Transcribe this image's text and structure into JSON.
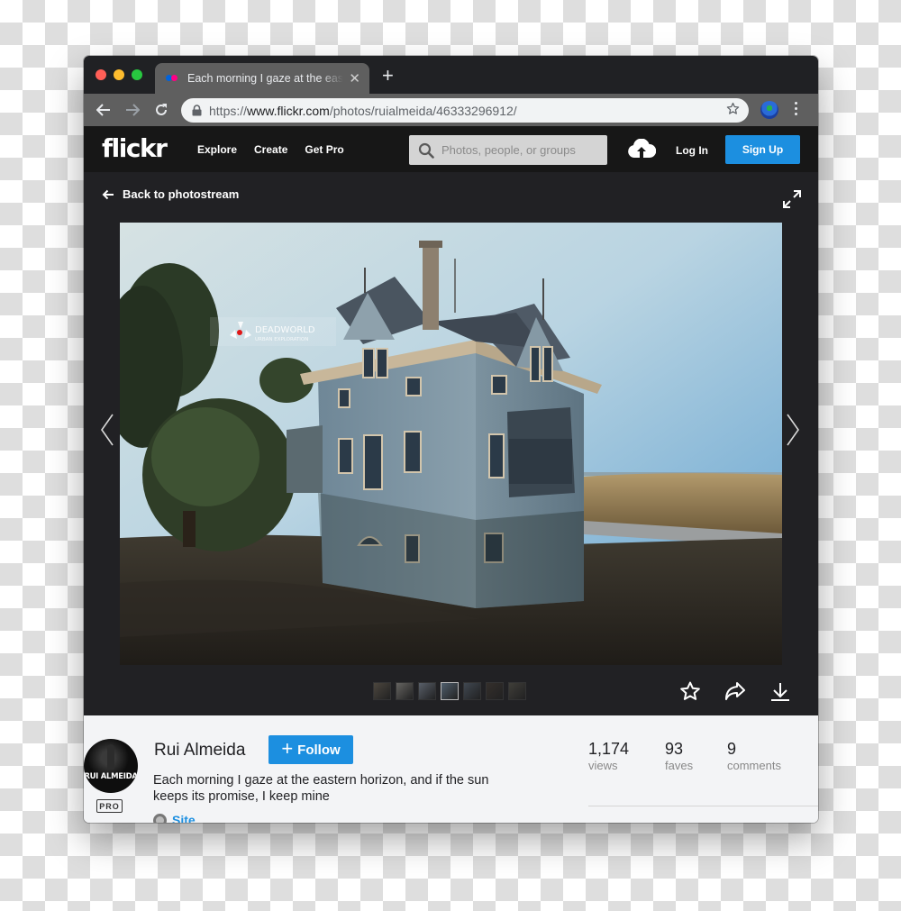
{
  "browser": {
    "tab_title": "Each morning I gaze at the eastern horizon, and if the sun keeps its promise, I keep mine",
    "url_prefix": "https://",
    "url_host": "www.flickr.com",
    "url_path": "/photos/ruialmeida/46333296912/",
    "new_tab_label": "+",
    "close_tab_label": "✕"
  },
  "header": {
    "logo": "flickr",
    "nav": [
      {
        "label": "Explore"
      },
      {
        "label": "Create"
      },
      {
        "label": "Get Pro"
      }
    ],
    "search_placeholder": "Photos, people, or groups",
    "login_label": "Log In",
    "signup_label": "Sign Up"
  },
  "stage": {
    "back_label": "Back to photostream",
    "watermark_title": "DEADWORLD",
    "watermark_subtitle": "URBAN EXPLORATION",
    "thumbnails_count": 7,
    "active_thumbnail_index": 3
  },
  "info": {
    "avatar_text": "RUI ALMEIDA",
    "pro_badge": "PRO",
    "author": "Rui Almeida",
    "follow_label": "Follow",
    "follow_plus": "+",
    "description": "Each morning I gaze at the eastern horizon, and if the sun keeps its promise, I keep mine",
    "site_label": "Site",
    "stats": [
      {
        "value": "1,174",
        "label": "views"
      },
      {
        "value": "93",
        "label": "faves"
      },
      {
        "value": "9",
        "label": "comments"
      }
    ]
  },
  "colors": {
    "accent": "#1c8fe0",
    "flickr_blue": "#0063dc",
    "flickr_pink": "#ff0084"
  }
}
